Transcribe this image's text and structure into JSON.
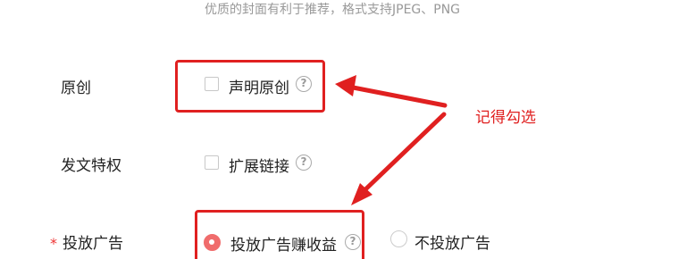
{
  "cover_hint": "优质的封面有利于推荐，格式支持JPEG、PNG",
  "rows": {
    "original": {
      "label": "原创",
      "option": "声明原创"
    },
    "privilege": {
      "label": "发文特权",
      "option": "扩展链接"
    },
    "ads": {
      "required_mark": "*",
      "label": "投放广告",
      "option_on": "投放广告赚收益",
      "option_off": "不投放广告"
    }
  },
  "annotation": {
    "text": "记得勾选"
  },
  "icons": {
    "help": "?"
  },
  "colors": {
    "highlight": "#e02020",
    "radio_active": "#f06c6c"
  }
}
